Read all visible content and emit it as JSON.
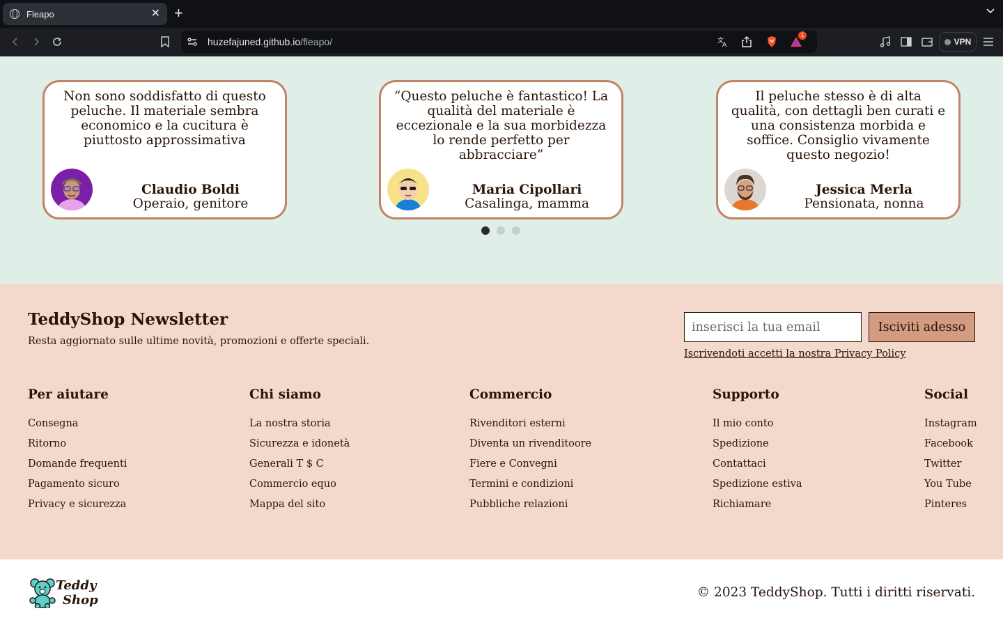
{
  "browser": {
    "tab_title": "Fleapo",
    "url_domain": "huzefajuned.github.io",
    "url_path": "/fleapo/",
    "notification_count": "1",
    "vpn_label": "VPN"
  },
  "testimonials": [
    {
      "quote": "Non sono soddisfatto di questo peluche. Il materiale sembra economico e la cucitura è piuttosto approssimativa",
      "name": "Claudio Boldi",
      "role": "Operaio, genitore"
    },
    {
      "quote": "“Questo peluche è fantastico! La qualità del materiale è eccezionale e la sua morbidezza lo rende perfetto per abbracciare”",
      "name": "Maria Cipollari",
      "role": "Casalinga, mamma"
    },
    {
      "quote": "Il peluche stesso è di alta qualità, con dettagli ben curati e una consistenza morbida e soffice. Consiglio vivamente questo negozio!",
      "name": "Jessica Merla",
      "role": "Pensionata, nonna"
    }
  ],
  "newsletter": {
    "title": "TeddyShop Newsletter",
    "subtitle": "Resta aggiornato sulle ultime novità, promozioni e offerte speciali.",
    "email_placeholder": "inserisci la tua email",
    "button_label": "Isciviti adesso",
    "privacy_text": "Iscrivendoti accetti la nostra Privacy Policy"
  },
  "footer_columns": [
    {
      "title": "Per aiutare",
      "links": [
        "Consegna",
        "Ritorno",
        "Domande frequenti",
        "Pagamento sicuro",
        "Privacy e sicurezza"
      ]
    },
    {
      "title": "Chi siamo",
      "links": [
        "La nostra storia",
        "Sicurezza e idonetà",
        "Generali T $ C",
        "Commercio equo",
        "Mappa del sito"
      ]
    },
    {
      "title": "Commercio",
      "links": [
        "Rivenditori esterni",
        "Diventa un rivenditoore",
        "Fiere e Convegni",
        "Termini e condizioni",
        "Pubbliche relazioni"
      ]
    },
    {
      "title": "Supporto",
      "links": [
        "Il mio conto",
        "Spedizione",
        "Contattaci",
        "Spedizione estiva",
        "Richiamare"
      ]
    },
    {
      "title": "Social",
      "links": [
        "Instagram",
        "Facebook",
        "Twitter",
        "You Tube",
        "Pinteres"
      ]
    }
  ],
  "bottom": {
    "logo_line1": "Teddy",
    "logo_line2": "Shop",
    "copyright": "© 2023 TeddyShop. Tutti i diritti riservati."
  }
}
